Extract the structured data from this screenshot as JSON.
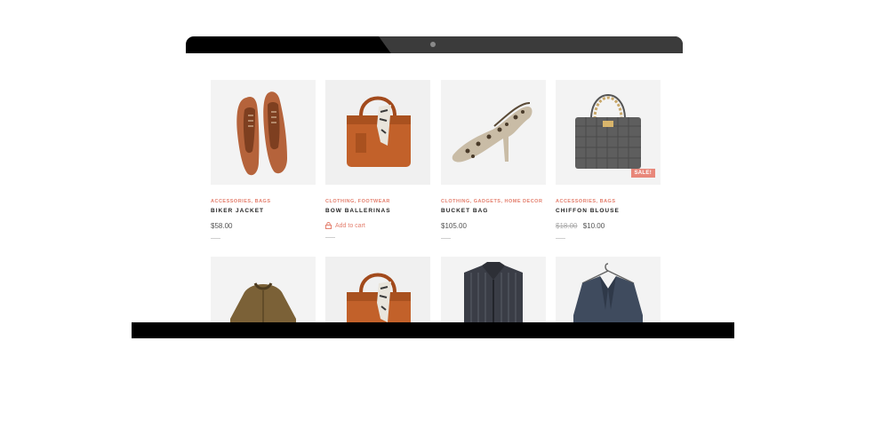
{
  "products": [
    {
      "category": "ACCESSORIES, BAGS",
      "title": "BIKER JACKET",
      "price": "$58.00",
      "old_price": "",
      "action": "",
      "sale": "",
      "image": "brogue-shoes"
    },
    {
      "category": "CLOTHING, FOOTWEAR",
      "title": "BOW BALLERINAS",
      "price": "",
      "old_price": "",
      "action": "Add to cart",
      "sale": "",
      "image": "leather-handbag-scarf"
    },
    {
      "category": "CLOTHING, GADGETS, HOME DECOR",
      "title": "BUCKET BAG",
      "price": "$105.00",
      "old_price": "",
      "action": "",
      "sale": "",
      "image": "leopard-heels"
    },
    {
      "category": "ACCESSORIES, BAGS",
      "title": "CHIFFON BLOUSE",
      "price": "$10.00",
      "old_price": "$18.00",
      "action": "",
      "sale": "SALE!",
      "image": "quilted-chain-bag"
    },
    {
      "image": "quilted-jacket"
    },
    {
      "image": "leather-handbag-scarf"
    },
    {
      "image": "striped-shirt"
    },
    {
      "image": "denim-jacket-hanger"
    }
  ],
  "colors": {
    "accent": "#e4806f",
    "sale_badge": "#e8877a",
    "laptop": "#000000",
    "laptop_sheen": "#3b3b3b"
  }
}
